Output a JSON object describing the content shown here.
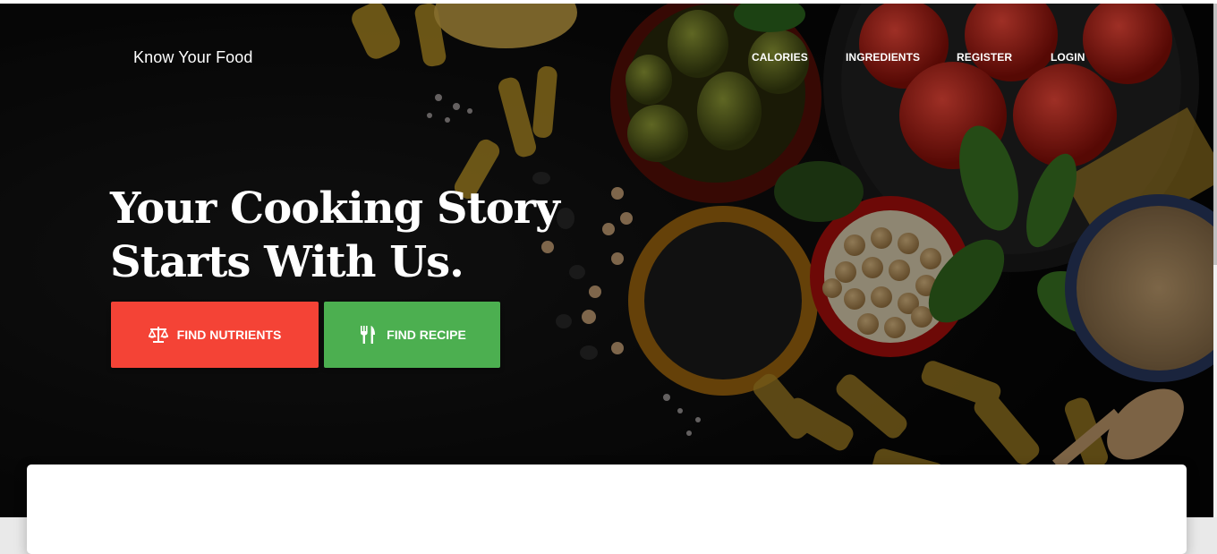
{
  "brand": {
    "name": "Know Your Food"
  },
  "nav": {
    "items": [
      {
        "label": "CALORIES"
      },
      {
        "label": "INGREDIENTS"
      },
      {
        "label": "REGISTER"
      },
      {
        "label": "LOGIN"
      }
    ]
  },
  "hero": {
    "headline_line1": "Your Cooking Story",
    "headline_line2": "Starts With Us.",
    "find_nutrients": {
      "label": "FIND NUTRIENTS",
      "icon": "balance-scale-icon",
      "color": "#f44336"
    },
    "find_recipe": {
      "label": "FIND RECIPE",
      "icon": "fork-knife-icon",
      "color": "#4caf50"
    }
  }
}
